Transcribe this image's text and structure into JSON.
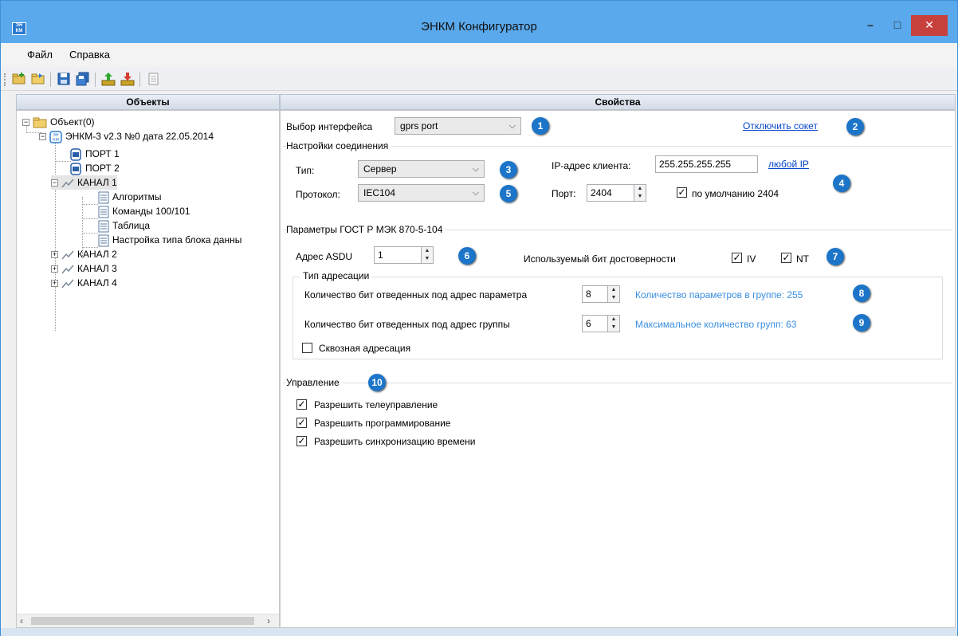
{
  "window": {
    "title": "ЭНКМ Конфигуратор",
    "icon_text": "ЭН КМ",
    "controls": {
      "minimize": "–",
      "maximize": "□",
      "close": "✕"
    }
  },
  "menu": [
    "Файл",
    "Справка"
  ],
  "toolbar": {
    "buttons": [
      "new-folder-icon",
      "open-folder-icon",
      "save-icon",
      "save-all-icon",
      "upload-icon",
      "download-icon",
      "document-icon"
    ]
  },
  "panes": {
    "objects": "Объекты",
    "properties": "Свойства"
  },
  "tree": {
    "root": "Объект(0)",
    "device": "ЭНКМ-3 v2.3 №0 дата 22.05.2014",
    "port1": "ПОРТ 1",
    "port2": "ПОРТ 2",
    "channel1": "КАНАЛ 1",
    "algorithms": "Алгоритмы",
    "commands": "Команды 100/101",
    "table": "Таблица",
    "block_type": "Настройка типа блока данны",
    "channel2": "КАНАЛ 2",
    "channel3": "КАНАЛ 3",
    "channel4": "КАНАЛ 4"
  },
  "props": {
    "interface_label": "Выбор интерфейса",
    "interface_value": "gprs port",
    "disconnect_link": "Отключить сокет",
    "connection": {
      "title": "Настройки соединения",
      "type_label": "Тип:",
      "type_value": "Сервер",
      "protocol_label": "Протокол:",
      "protocol_value": "IEC104",
      "ip_label": "IP-адрес клиента:",
      "ip_value": "255.255.255.255",
      "any_ip_link": "любой IP",
      "port_label": "Порт:",
      "port_value": "2404",
      "default_port_label": "по умолчанию 2404",
      "default_port_checked": true
    },
    "gost": {
      "title": "Параметры ГОСТ Р МЭК 870-5-104",
      "asdu_label": "Адрес ASDU",
      "asdu_value": "1",
      "validity_label": "Используемый бит достоверности",
      "iv_label": "IV",
      "iv_checked": true,
      "nt_label": "NT",
      "nt_checked": true,
      "addressing": {
        "title": "Тип адресации",
        "param_bits_label": "Количество бит отведенных под адрес параметра",
        "param_bits_value": "8",
        "param_count_info": "Количество параметров в группе: 255",
        "group_bits_label": "Количество бит отведенных под адрес группы",
        "group_bits_value": "6",
        "group_count_info": "Максимальное количество групп: 63",
        "through_label": "Сквозная адресация",
        "through_checked": false
      }
    },
    "control": {
      "title": "Управление",
      "telecontrol": "Разрешить телеуправление",
      "programming": "Разрешить программирование",
      "time_sync": "Разрешить синхронизацию времени"
    },
    "badges": [
      "1",
      "2",
      "3",
      "4",
      "5",
      "6",
      "7",
      "8",
      "9",
      "10"
    ]
  },
  "colors": {
    "accent": "#1c75c8",
    "link": "#0645c8",
    "info": "#3a8fe0",
    "titlebar": "#5aa9ec",
    "close": "#c7403b"
  }
}
